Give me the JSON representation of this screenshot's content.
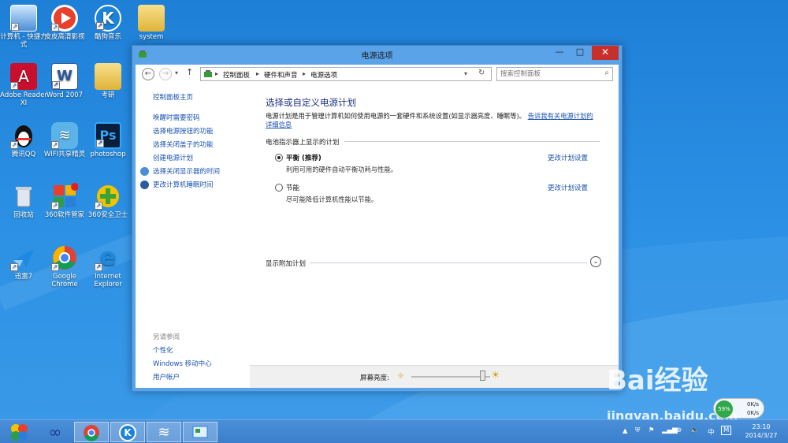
{
  "desktop": {
    "icons": [
      {
        "label": "计算机 - 快捷方式"
      },
      {
        "label": "皮皮高清影视"
      },
      {
        "label": "酷狗音乐"
      },
      {
        "label": "system"
      },
      {
        "label": "Adobe Reader XI"
      },
      {
        "label": "Word 2007"
      },
      {
        "label": "考研"
      },
      {
        "label": "腾讯QQ"
      },
      {
        "label": "WIFI共享精灵"
      },
      {
        "label": "photoshop"
      },
      {
        "label": "回收站"
      },
      {
        "label": "360软件管家"
      },
      {
        "label": "360安全卫士"
      },
      {
        "label": "迅雷7"
      },
      {
        "label": "Google Chrome"
      },
      {
        "label": "Internet Explorer"
      }
    ]
  },
  "window": {
    "title": "电源选项",
    "controls": {
      "minimize": "—",
      "maximize": "□",
      "close": "✕"
    }
  },
  "address": {
    "crumbs": [
      "控制面板",
      "硬件和声音",
      "电源选项"
    ],
    "search_placeholder": "搜索控制面板"
  },
  "sidebar": {
    "home": "控制面板主页",
    "links": [
      "唤醒时需要密码",
      "选择电源按钮的功能",
      "选择关闭盖子的功能",
      "创建电源计划",
      "选择关闭显示器的时间",
      "更改计算机睡眠时间"
    ],
    "see_also_title": "另请参阅",
    "see_also": [
      "个性化",
      "Windows 移动中心",
      "用户帐户"
    ]
  },
  "main": {
    "title": "选择或自定义电源计划",
    "description": "电源计划是用于管理计算机如何使用电源的一套硬件和系统设置(如显示器亮度、睡眠等)。",
    "description_link": "告诉我有关电源计划的详细信息",
    "group_label": "电池指示器上显示的计划",
    "plans": [
      {
        "name": "平衡 (推荐)",
        "desc": "利用可用的硬件自动平衡功耗与性能。",
        "link": "更改计划设置",
        "selected": true
      },
      {
        "name": "节能",
        "desc": "尽可能降低计算机性能以节能。",
        "link": "更改计划设置",
        "selected": false
      }
    ],
    "extra_plans": "显示附加计划"
  },
  "footer": {
    "brightness_label": "屏幕亮度:",
    "brightness_level": 0.9
  },
  "taskbar": {
    "tray_lang": "中",
    "tray_ime": "M",
    "time": "23:10",
    "date": "2014/3/27"
  },
  "speed_widget": {
    "percent": "59%",
    "up": "0K/s",
    "down": "0K/s"
  },
  "watermark": {
    "brand": "Bai经验",
    "url": "jingyan.baidu.com"
  },
  "colors": {
    "accent": "#1a52b0",
    "title_blue": "#1e3287",
    "close_red": "#c7302a"
  }
}
